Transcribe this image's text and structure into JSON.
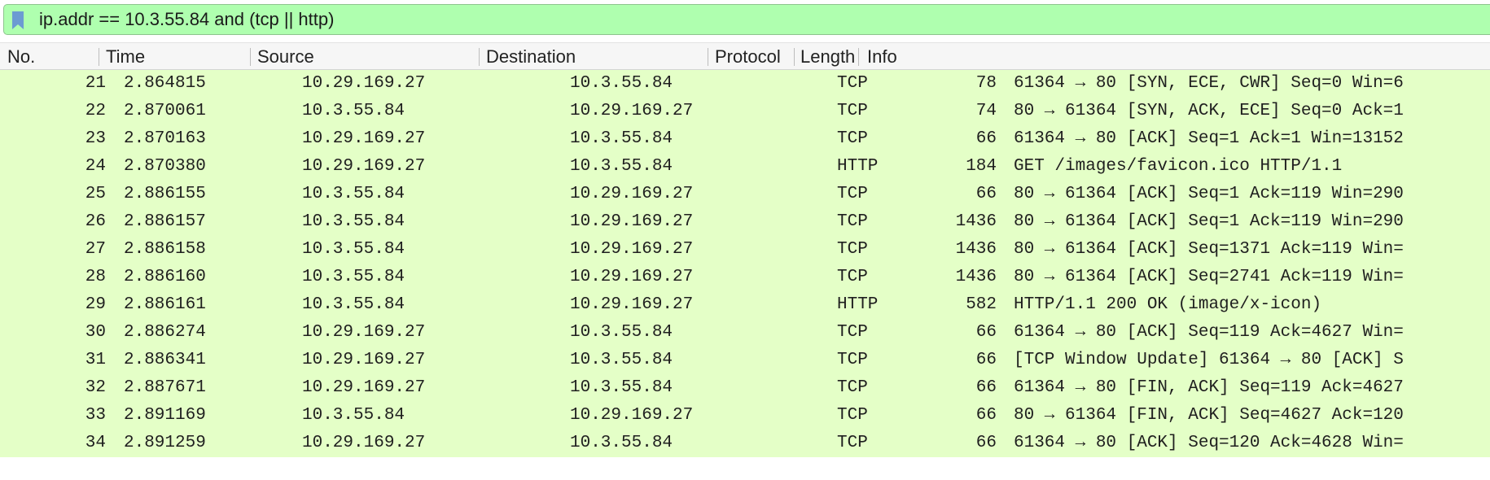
{
  "filter": {
    "expression": "ip.addr == 10.3.55.84 and (tcp || http)"
  },
  "columns": [
    "No.",
    "Time",
    "Source",
    "Destination",
    "Protocol",
    "Length",
    "Info"
  ],
  "colors": {
    "filter_valid_bg": "#afffaf",
    "row_bg": "#e4ffc7",
    "bookmark_icon": "#6c9bd2"
  },
  "packets": [
    {
      "no": "21",
      "time": "2.864815",
      "source": "10.29.169.27",
      "destination": "10.3.55.84",
      "protocol": "TCP",
      "length": "78",
      "info": "61364 → 80 [SYN, ECE, CWR] Seq=0 Win=6"
    },
    {
      "no": "22",
      "time": "2.870061",
      "source": "10.3.55.84",
      "destination": "10.29.169.27",
      "protocol": "TCP",
      "length": "74",
      "info": "80 → 61364 [SYN, ACK, ECE] Seq=0 Ack=1"
    },
    {
      "no": "23",
      "time": "2.870163",
      "source": "10.29.169.27",
      "destination": "10.3.55.84",
      "protocol": "TCP",
      "length": "66",
      "info": "61364 → 80 [ACK] Seq=1 Ack=1 Win=13152"
    },
    {
      "no": "24",
      "time": "2.870380",
      "source": "10.29.169.27",
      "destination": "10.3.55.84",
      "protocol": "HTTP",
      "length": "184",
      "info": "GET /images/favicon.ico HTTP/1.1"
    },
    {
      "no": "25",
      "time": "2.886155",
      "source": "10.3.55.84",
      "destination": "10.29.169.27",
      "protocol": "TCP",
      "length": "66",
      "info": "80 → 61364 [ACK] Seq=1 Ack=119 Win=290"
    },
    {
      "no": "26",
      "time": "2.886157",
      "source": "10.3.55.84",
      "destination": "10.29.169.27",
      "protocol": "TCP",
      "length": "1436",
      "info": "80 → 61364 [ACK] Seq=1 Ack=119 Win=290"
    },
    {
      "no": "27",
      "time": "2.886158",
      "source": "10.3.55.84",
      "destination": "10.29.169.27",
      "protocol": "TCP",
      "length": "1436",
      "info": "80 → 61364 [ACK] Seq=1371 Ack=119 Win="
    },
    {
      "no": "28",
      "time": "2.886160",
      "source": "10.3.55.84",
      "destination": "10.29.169.27",
      "protocol": "TCP",
      "length": "1436",
      "info": "80 → 61364 [ACK] Seq=2741 Ack=119 Win="
    },
    {
      "no": "29",
      "time": "2.886161",
      "source": "10.3.55.84",
      "destination": "10.29.169.27",
      "protocol": "HTTP",
      "length": "582",
      "info": "HTTP/1.1 200 OK  (image/x-icon)"
    },
    {
      "no": "30",
      "time": "2.886274",
      "source": "10.29.169.27",
      "destination": "10.3.55.84",
      "protocol": "TCP",
      "length": "66",
      "info": "61364 → 80 [ACK] Seq=119 Ack=4627 Win="
    },
    {
      "no": "31",
      "time": "2.886341",
      "source": "10.29.169.27",
      "destination": "10.3.55.84",
      "protocol": "TCP",
      "length": "66",
      "info": "[TCP Window Update] 61364 → 80 [ACK] S"
    },
    {
      "no": "32",
      "time": "2.887671",
      "source": "10.29.169.27",
      "destination": "10.3.55.84",
      "protocol": "TCP",
      "length": "66",
      "info": "61364 → 80 [FIN, ACK] Seq=119 Ack=4627"
    },
    {
      "no": "33",
      "time": "2.891169",
      "source": "10.3.55.84",
      "destination": "10.29.169.27",
      "protocol": "TCP",
      "length": "66",
      "info": "80 → 61364 [FIN, ACK] Seq=4627 Ack=120"
    },
    {
      "no": "34",
      "time": "2.891259",
      "source": "10.29.169.27",
      "destination": "10.3.55.84",
      "protocol": "TCP",
      "length": "66",
      "info": "61364 → 80 [ACK] Seq=120 Ack=4628 Win="
    }
  ]
}
